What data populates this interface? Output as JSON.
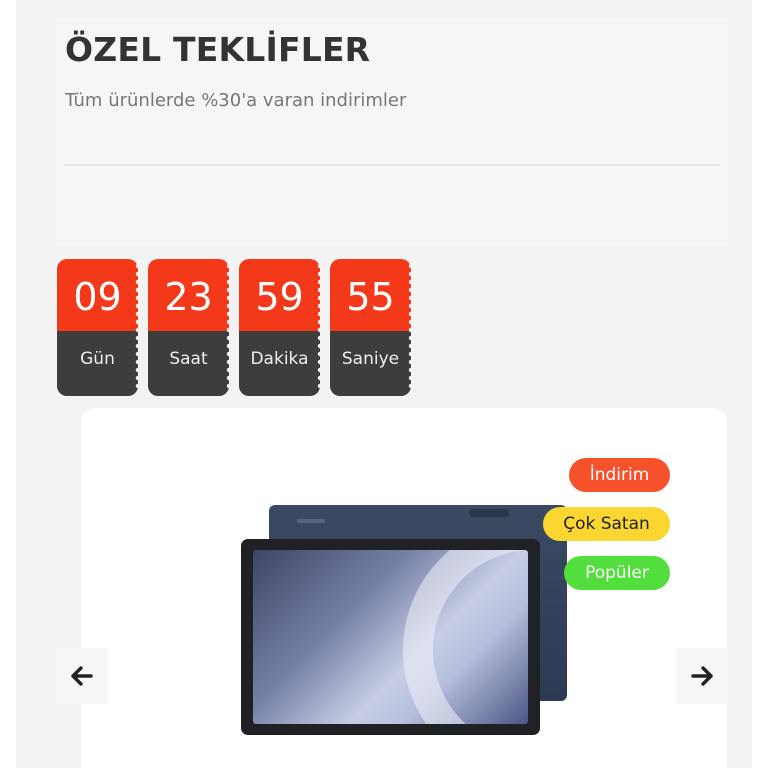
{
  "offers": {
    "title": "ÖZEL TEKLİFLER",
    "subtitle": "Tüm ürünlerde %30'a varan indirimler"
  },
  "countdown": [
    {
      "value": "09",
      "label": "Gün"
    },
    {
      "value": "23",
      "label": "Saat"
    },
    {
      "value": "59",
      "label": "Dakika"
    },
    {
      "value": "55",
      "label": "Saniye"
    }
  ],
  "product": {
    "badges": {
      "discount": "İndirim",
      "bestseller": "Çok Satan",
      "popular": "Popüler"
    }
  },
  "carousel": {
    "prev_icon": "arrow-left-icon",
    "next_icon": "arrow-right-icon"
  },
  "colors": {
    "countdown_top": "#f4391b",
    "countdown_bottom": "#3d3d3d",
    "badge_discount": "#f5512b",
    "badge_bestseller": "#fbd631",
    "badge_popular": "#52de3d"
  }
}
